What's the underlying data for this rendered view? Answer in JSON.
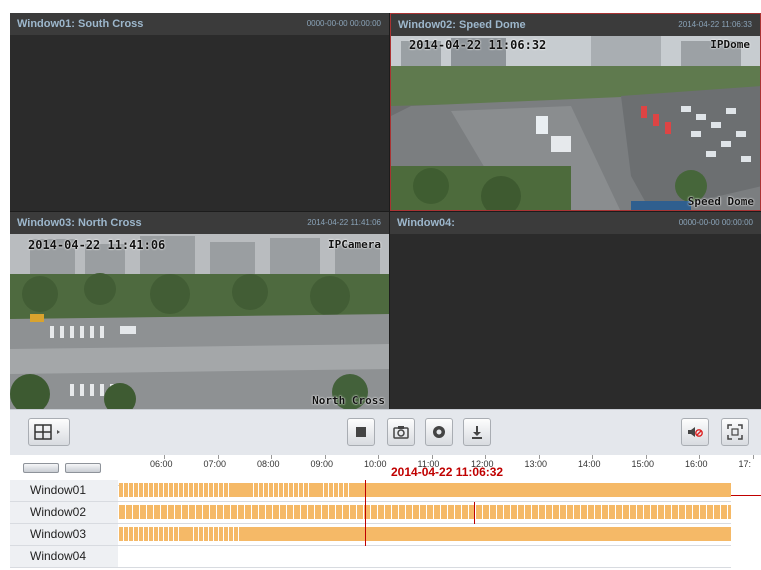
{
  "windows": [
    {
      "name": "Window01: South Cross",
      "timestamp": "0000-00-00 00:00:00",
      "osd_time": "",
      "osd_cam": ""
    },
    {
      "name": "Window02: Speed Dome",
      "timestamp": "2014-04-22 11:06:33",
      "osd_time": "2014-04-22 11:06:32",
      "osd_cam": "IPDome",
      "osd_label": "Speed Dome"
    },
    {
      "name": "Window03: North Cross",
      "timestamp": "2014-04-22 11:41:06",
      "osd_time": "2014-04-22 11:41:06",
      "osd_cam": "IPCamera",
      "osd_label": "North Cross"
    },
    {
      "name": "Window04:",
      "timestamp": "0000-00-00 00:00:00",
      "osd_time": "",
      "osd_cam": ""
    }
  ],
  "controls": {
    "layout_icon": "grid-layout-icon",
    "stop_icon": "stop-icon",
    "capture_icon": "camera-icon",
    "record_icon": "record-icon",
    "download_icon": "download-icon",
    "mute_icon": "mute-icon",
    "fullscreen_icon": "fullscreen-icon"
  },
  "timeline": {
    "ticks": [
      "06:00",
      "07:00",
      "08:00",
      "09:00",
      "10:00",
      "11:00",
      "12:00",
      "13:00",
      "14:00",
      "15:00",
      "16:00",
      "17:"
    ],
    "current_time": "2014-04-22 11:06:32",
    "rows": [
      {
        "label": "Window01"
      },
      {
        "label": "Window02"
      },
      {
        "label": "Window03"
      },
      {
        "label": "Window04"
      }
    ]
  },
  "colors": {
    "record": "#f5b967",
    "cursor": "#c00000",
    "active_border": "#a33333"
  }
}
